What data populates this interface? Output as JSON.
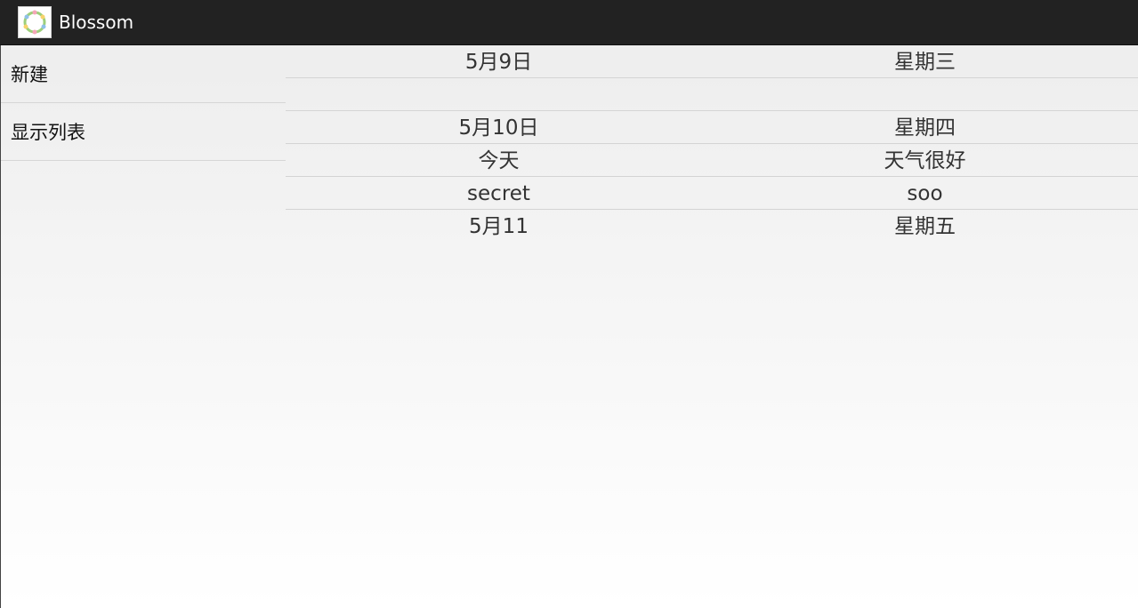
{
  "app": {
    "title": "Blossom",
    "icon": "flower-wreath-icon"
  },
  "menu": {
    "items": [
      {
        "label": "新建"
      },
      {
        "label": "显示列表"
      }
    ]
  },
  "list": {
    "rows": [
      {
        "col1": "5月9日",
        "col2": "星期三"
      },
      {
        "col1": "",
        "col2": ""
      },
      {
        "col1": "5月10日",
        "col2": "星期四"
      },
      {
        "col1": "今天",
        "col2": "天气很好"
      },
      {
        "col1": "secret",
        "col2": "soo"
      },
      {
        "col1": "5月11",
        "col2": "星期五"
      }
    ]
  },
  "colors": {
    "action_bar": "#222222",
    "text": "#333333"
  }
}
